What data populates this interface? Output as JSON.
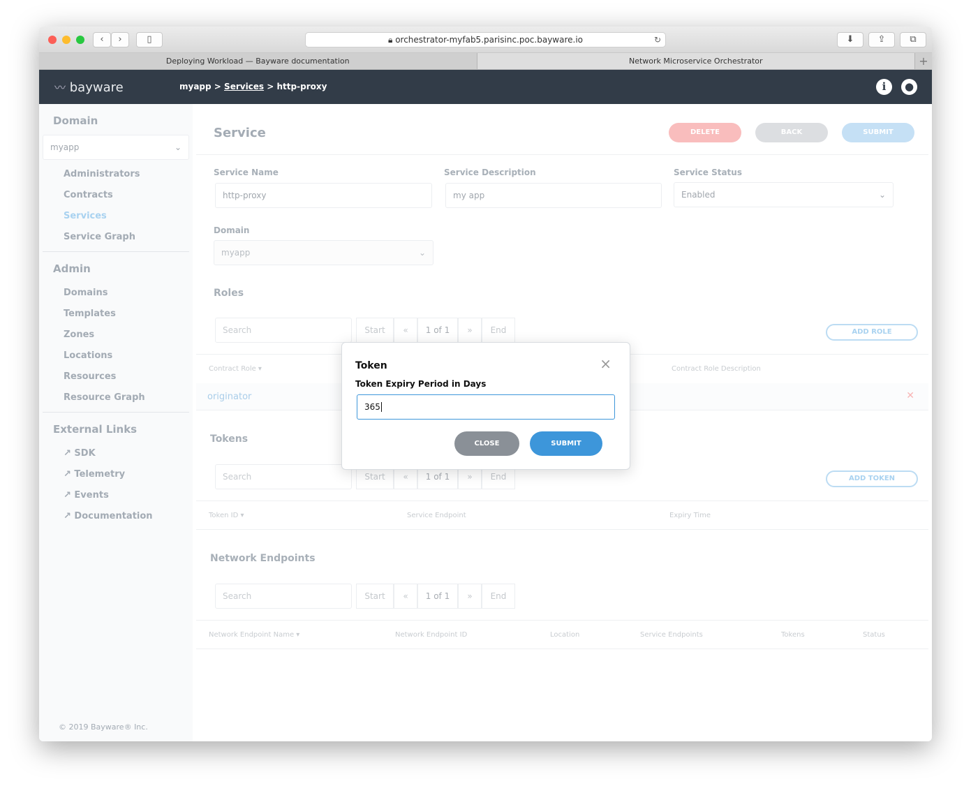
{
  "browser": {
    "url": "orchestrator-myfab5.parisinc.poc.bayware.io",
    "tabs": [
      "Deploying Workload — Bayware documentation",
      "Network Microservice Orchestrator"
    ]
  },
  "header": {
    "logo": "bayware",
    "breadcrumb": [
      "myapp",
      ">",
      "Services",
      ">",
      "http-proxy"
    ]
  },
  "sidebar": {
    "domain_heading": "Domain",
    "domain_select": "myapp",
    "domain_items": [
      "Administrators",
      "Contracts",
      "Services",
      "Service Graph"
    ],
    "admin_heading": "Admin",
    "admin_items": [
      "Domains",
      "Templates",
      "Zones",
      "Locations",
      "Resources",
      "Resource Graph"
    ],
    "links_heading": "External Links",
    "links": [
      "SDK",
      "Telemetry",
      "Events",
      "Documentation"
    ],
    "footer": "© 2019 Bayware® Inc."
  },
  "main": {
    "title": "Service",
    "delete": "DELETE",
    "back": "BACK",
    "submit": "SUBMIT",
    "service_name_label": "Service Name",
    "service_name": "http-proxy",
    "service_desc_label": "Service Description",
    "service_desc": "my app",
    "service_status_label": "Service Status",
    "service_status": "Enabled",
    "domain_label": "Domain",
    "domain": "myapp",
    "roles": {
      "heading": "Roles",
      "search": "Search",
      "add": "ADD ROLE",
      "columns": [
        "Contract Role",
        "Contract Role Description"
      ],
      "rows": [
        "originator"
      ]
    },
    "tokens": {
      "heading": "Tokens",
      "search": "Search",
      "add": "ADD TOKEN",
      "columns": [
        "Token ID",
        "Service Endpoint",
        "Expiry Time"
      ]
    },
    "endpoints": {
      "heading": "Network Endpoints",
      "search": "Search",
      "columns": [
        "Network Endpoint Name",
        "Network Endpoint ID",
        "Location",
        "Service Endpoints",
        "Tokens",
        "Status"
      ]
    },
    "pager": {
      "start": "Start",
      "prev": "«",
      "page": "1 of 1",
      "next": "»",
      "end": "End"
    }
  },
  "modal": {
    "title": "Token",
    "label": "Token Expiry Period in Days",
    "value": "365",
    "close": "CLOSE",
    "submit": "SUBMIT"
  },
  "colors": {
    "header": "#323c48",
    "accent": "#3d96da",
    "delete": "#f25c5c",
    "close_btn": "#8a9097"
  }
}
